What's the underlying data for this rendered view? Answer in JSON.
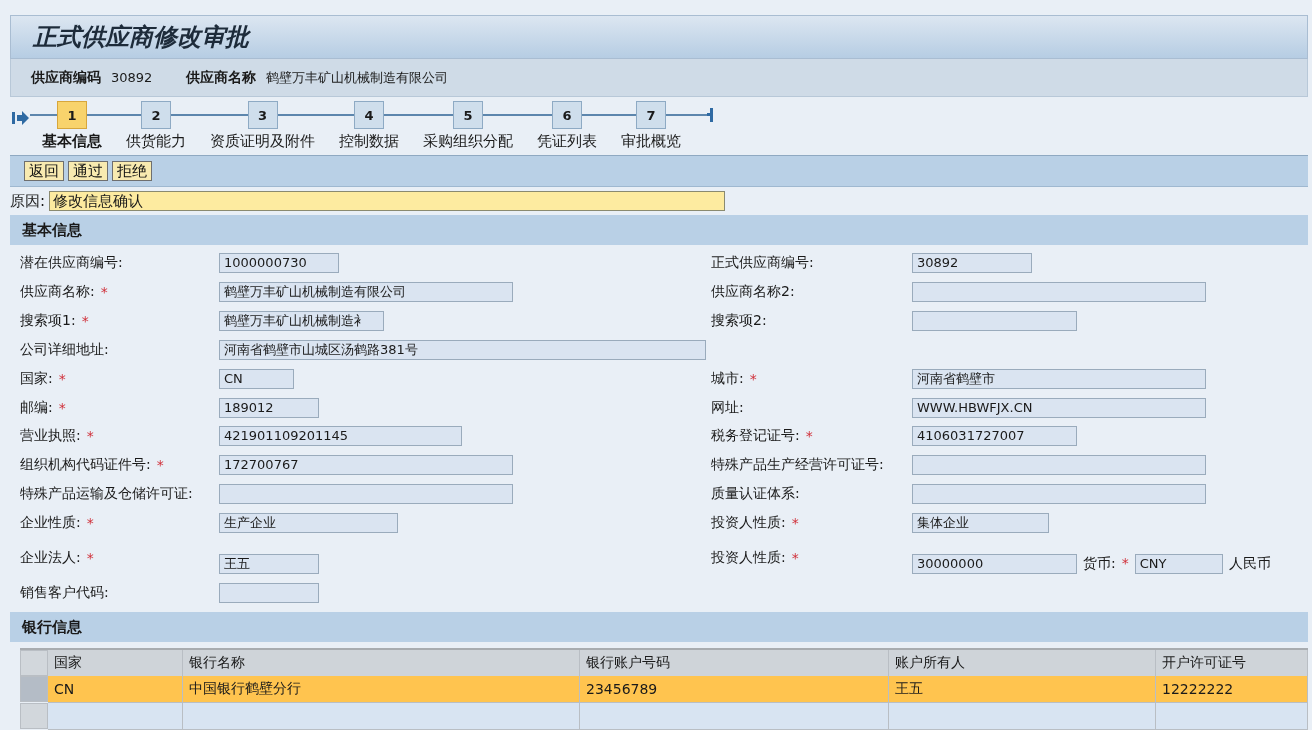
{
  "title": "正式供应商修改审批",
  "info": [
    {
      "label": "供应商编码",
      "value": "30892"
    },
    {
      "label": "供应商名称",
      "value": "鹤壁万丰矿山机械制造有限公司"
    }
  ],
  "steps": [
    {
      "number": "1",
      "label": "基本信息",
      "selected": true
    },
    {
      "number": "2",
      "label": "供货能力",
      "selected": false
    },
    {
      "number": "3",
      "label": "资质证明及附件",
      "selected": false
    },
    {
      "number": "4",
      "label": "控制数据",
      "selected": false
    },
    {
      "number": "5",
      "label": "采购组织分配",
      "selected": false
    },
    {
      "number": "6",
      "label": "凭证列表",
      "selected": false
    },
    {
      "number": "7",
      "label": "审批概览",
      "selected": false
    }
  ],
  "toolbar": [
    "返回",
    "通过",
    "拒绝"
  ],
  "reason": {
    "label": "原因:",
    "value": "修改信息确认"
  },
  "required_mark": "*",
  "basic_section": "基本信息",
  "form_rows": [
    {
      "left": {
        "label": "潜在供应商编号:",
        "required": false,
        "value": "1000000730"
      },
      "right": {
        "label": "正式供应商编号:",
        "required": false,
        "value": "30892"
      }
    },
    {
      "left": {
        "label": "供应商名称:",
        "required": true,
        "value": "鹤壁万丰矿山机械制造有限公司"
      },
      "right": {
        "label": "供应商名称2:",
        "required": false
      }
    },
    {
      "left": {
        "label": "搜索项1:",
        "required": true,
        "value": "鹤壁万丰矿山机械制造衤"
      },
      "right": {
        "label": "搜索项2:",
        "required": false
      }
    },
    {
      "left": {
        "label": "公司详细地址:",
        "required": false,
        "value": "河南省鹤壁市山城区汤鹤路381号"
      }
    },
    {
      "left": {
        "label": "国家:",
        "required": true,
        "value": "CN"
      },
      "right": {
        "label": "城市:",
        "required": true,
        "value": "河南省鹤壁市"
      }
    },
    {
      "left": {
        "label": "邮编:",
        "required": true,
        "value": "189012"
      },
      "right": {
        "label": "网址:",
        "required": false,
        "value": "WWW.HBWFJX.CN"
      }
    },
    {
      "left": {
        "label": "营业执照:",
        "required": true,
        "value": "421901109201145"
      },
      "right": {
        "label": "税务登记证号:",
        "required": true,
        "value": "4106031727007"
      }
    },
    {
      "left": {
        "label": "组织机构代码证件号:",
        "required": true,
        "value": "172700767"
      },
      "right": {
        "label": "特殊产品生产经营许可证号:",
        "required": false
      }
    },
    {
      "left": {
        "label": "特殊产品运输及仓储许可证:",
        "required": false
      },
      "right": {
        "label": "质量认证体系:",
        "required": false
      }
    },
    {
      "left": {
        "label": "企业性质:",
        "required": true,
        "value": "生产企业"
      },
      "right": {
        "label": "投资人性质:",
        "required": true,
        "value": "集体企业"
      }
    },
    {
      "left": {
        "label": "企业法人:",
        "required": true,
        "value": "王五"
      },
      "right": {
        "label": "投资人性质:",
        "required": true,
        "value": "30000000",
        "currency": {
          "label": "货币:",
          "required": true,
          "value": "CNY",
          "text": "人民币"
        }
      }
    },
    {
      "left": {
        "label": "销售客户代码:",
        "required": false
      }
    }
  ],
  "bank_section": "银行信息",
  "bank_table": {
    "columns": [
      "国家",
      "银行名称",
      "银行账户号码",
      "账户所有人",
      "开户许可证号"
    ],
    "rows": [
      {
        "selected": true,
        "cells": [
          "CN",
          "中国银行鹤壁分行",
          "23456789",
          "王五",
          "12222222"
        ]
      },
      {
        "selected": false
      }
    ]
  }
}
